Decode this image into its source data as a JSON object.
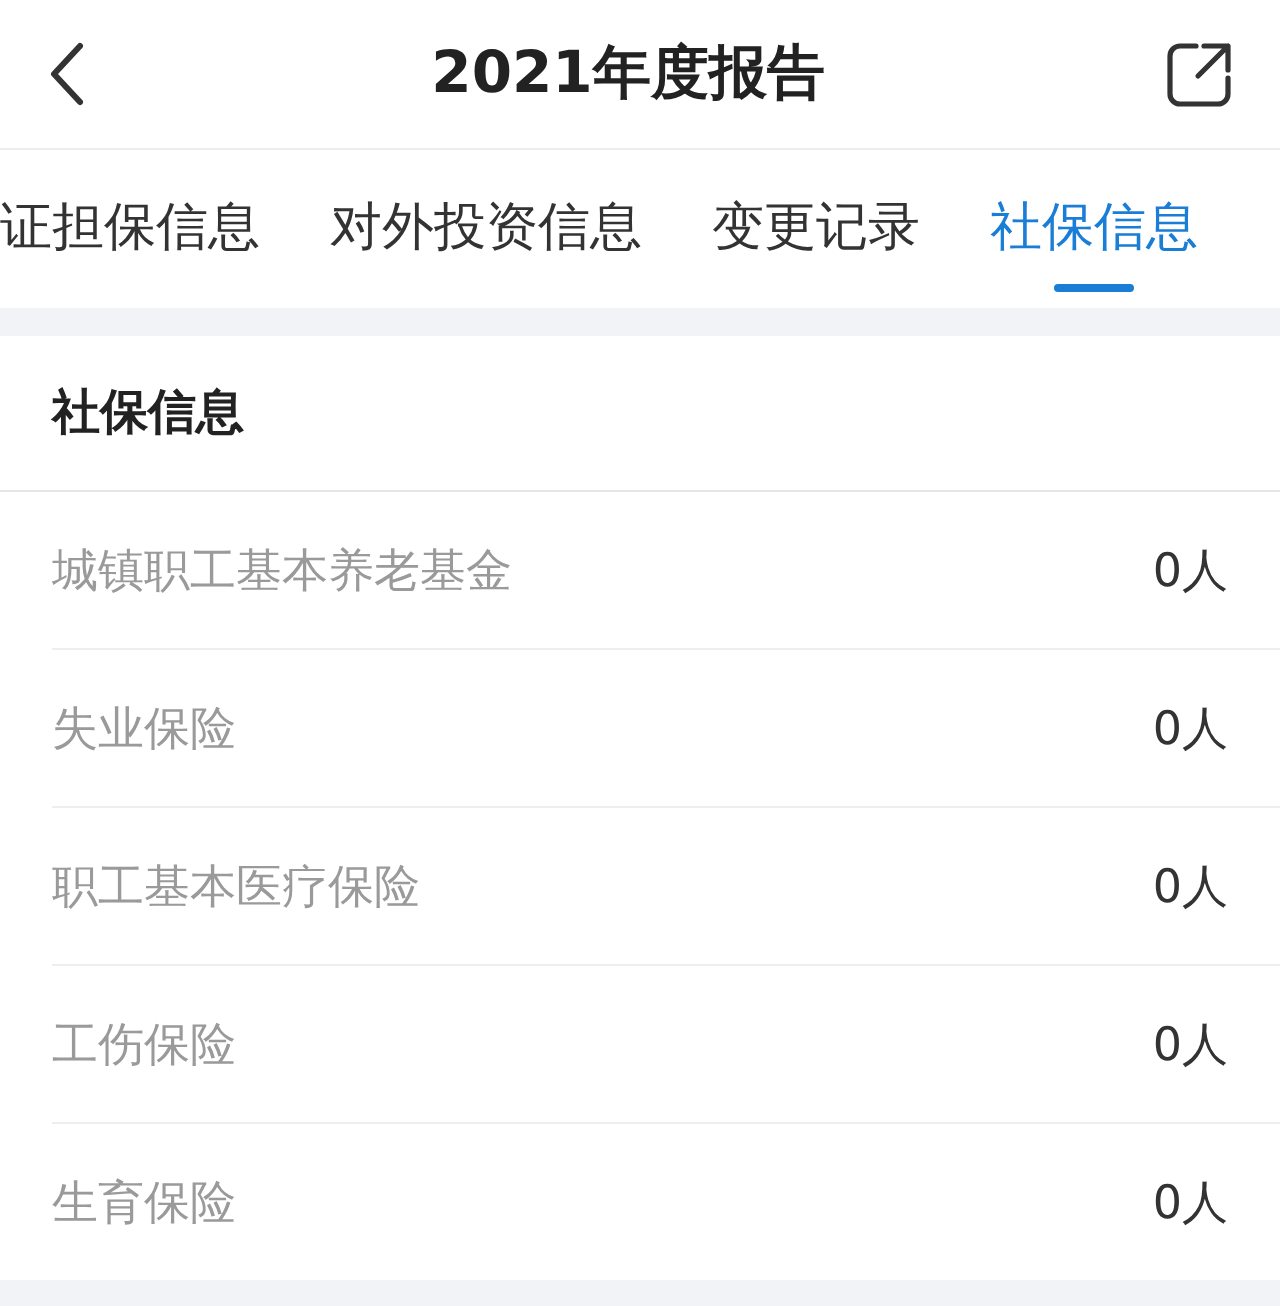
{
  "header": {
    "title": "2021年度报告"
  },
  "tabs": [
    {
      "label": "证担保信息",
      "selected": false
    },
    {
      "label": "对外投资信息",
      "selected": false
    },
    {
      "label": "变更记录",
      "selected": false
    },
    {
      "label": "社保信息",
      "selected": true
    }
  ],
  "section": {
    "title": "社保信息",
    "rows": [
      {
        "label": "城镇职工基本养老基金",
        "value": "0人"
      },
      {
        "label": "失业保险",
        "value": "0人"
      },
      {
        "label": "职工基本医疗保险",
        "value": "0人"
      },
      {
        "label": "工伤保险",
        "value": "0人"
      },
      {
        "label": "生育保险",
        "value": "0人"
      }
    ]
  }
}
